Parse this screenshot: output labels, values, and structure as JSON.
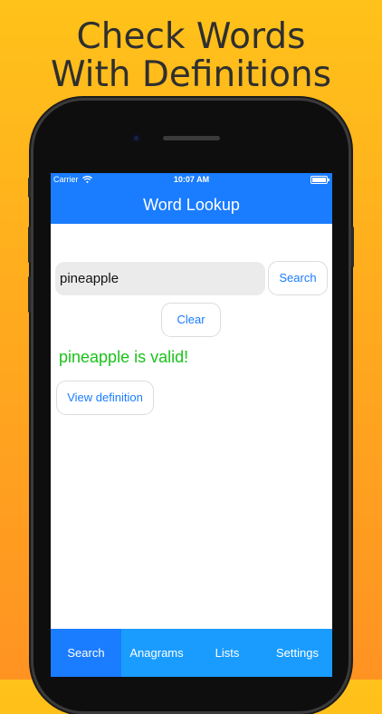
{
  "headline": {
    "line1": "Check Words",
    "line2": "With Definitions"
  },
  "status_bar": {
    "carrier": "Carrier",
    "time": "10:07 AM"
  },
  "nav": {
    "title": "Word Lookup"
  },
  "search": {
    "value": "pineapple",
    "button_label": "Search"
  },
  "clear_button_label": "Clear",
  "result_text": "pineapple is valid!",
  "view_definition_label": "View definition",
  "tabs": [
    {
      "label": "Search",
      "active": true
    },
    {
      "label": "Anagrams",
      "active": false
    },
    {
      "label": "Lists",
      "active": false
    },
    {
      "label": "Settings",
      "active": false
    }
  ],
  "colors": {
    "background_top": "#ffc21a",
    "background_bottom": "#ff9322",
    "nav_blue": "#1a7cff",
    "tab_blue": "#1a9cff",
    "valid_green": "#1ac21a"
  },
  "icons": {
    "wifi": "wifi-icon",
    "battery": "battery-icon"
  }
}
